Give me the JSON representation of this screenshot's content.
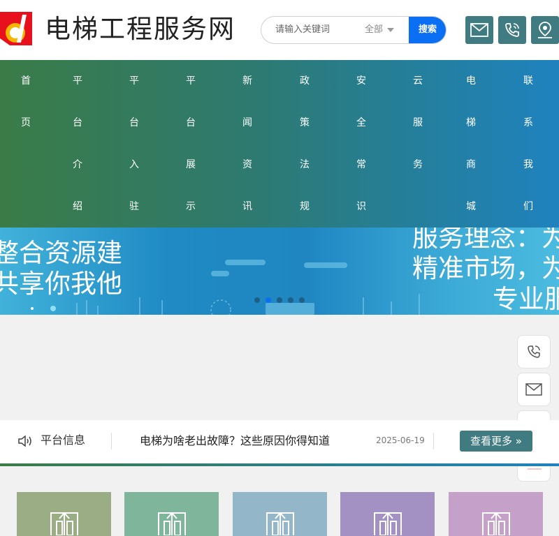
{
  "header": {
    "site_title": "电梯工程服务网",
    "logo_icon": "logo-d-icon",
    "search": {
      "placeholder": "请输入关键词",
      "scope": "全部",
      "button": "搜索"
    },
    "actions": [
      {
        "icon": "mail-icon"
      },
      {
        "icon": "phone-icon"
      },
      {
        "icon": "location-icon"
      }
    ]
  },
  "nav": {
    "items": [
      {
        "label": "首页"
      },
      {
        "label": "平台介绍"
      },
      {
        "label": "平台入驻"
      },
      {
        "label": "平台展示"
      },
      {
        "label": "新闻资讯"
      },
      {
        "label": "政策法规"
      },
      {
        "label": "安全常识"
      },
      {
        "label": "云服务"
      },
      {
        "label": "电梯商城"
      },
      {
        "label": "联系我们"
      }
    ],
    "colors": {
      "start": "#3a7b47",
      "end": "#1f82be"
    }
  },
  "banner": {
    "left_text": [
      "整合资源建",
      "共享你我他"
    ],
    "right_text": [
      "服务理念：为",
      "精准市场，为",
      "专业服"
    ],
    "slides_count": 5,
    "active_slide": 1
  },
  "float_bar": [
    {
      "icon": "phone-icon"
    },
    {
      "icon": "mail-icon"
    }
  ],
  "notice": {
    "label": "平台信息",
    "title": "电梯为啥老出故障？这些原因你得知道",
    "date": "2025-06-19",
    "more": "查看更多"
  },
  "cards": [
    {
      "color": "#9aad84",
      "icon": "elevator-icon"
    },
    {
      "color": "#7fb59a",
      "icon": "elevator-icon"
    },
    {
      "color": "#93b6c9",
      "icon": "elevator-icon"
    },
    {
      "color": "#a391c3",
      "icon": "elevator-icon"
    },
    {
      "color": "#c5a1c9",
      "icon": "elevator-icon"
    }
  ]
}
